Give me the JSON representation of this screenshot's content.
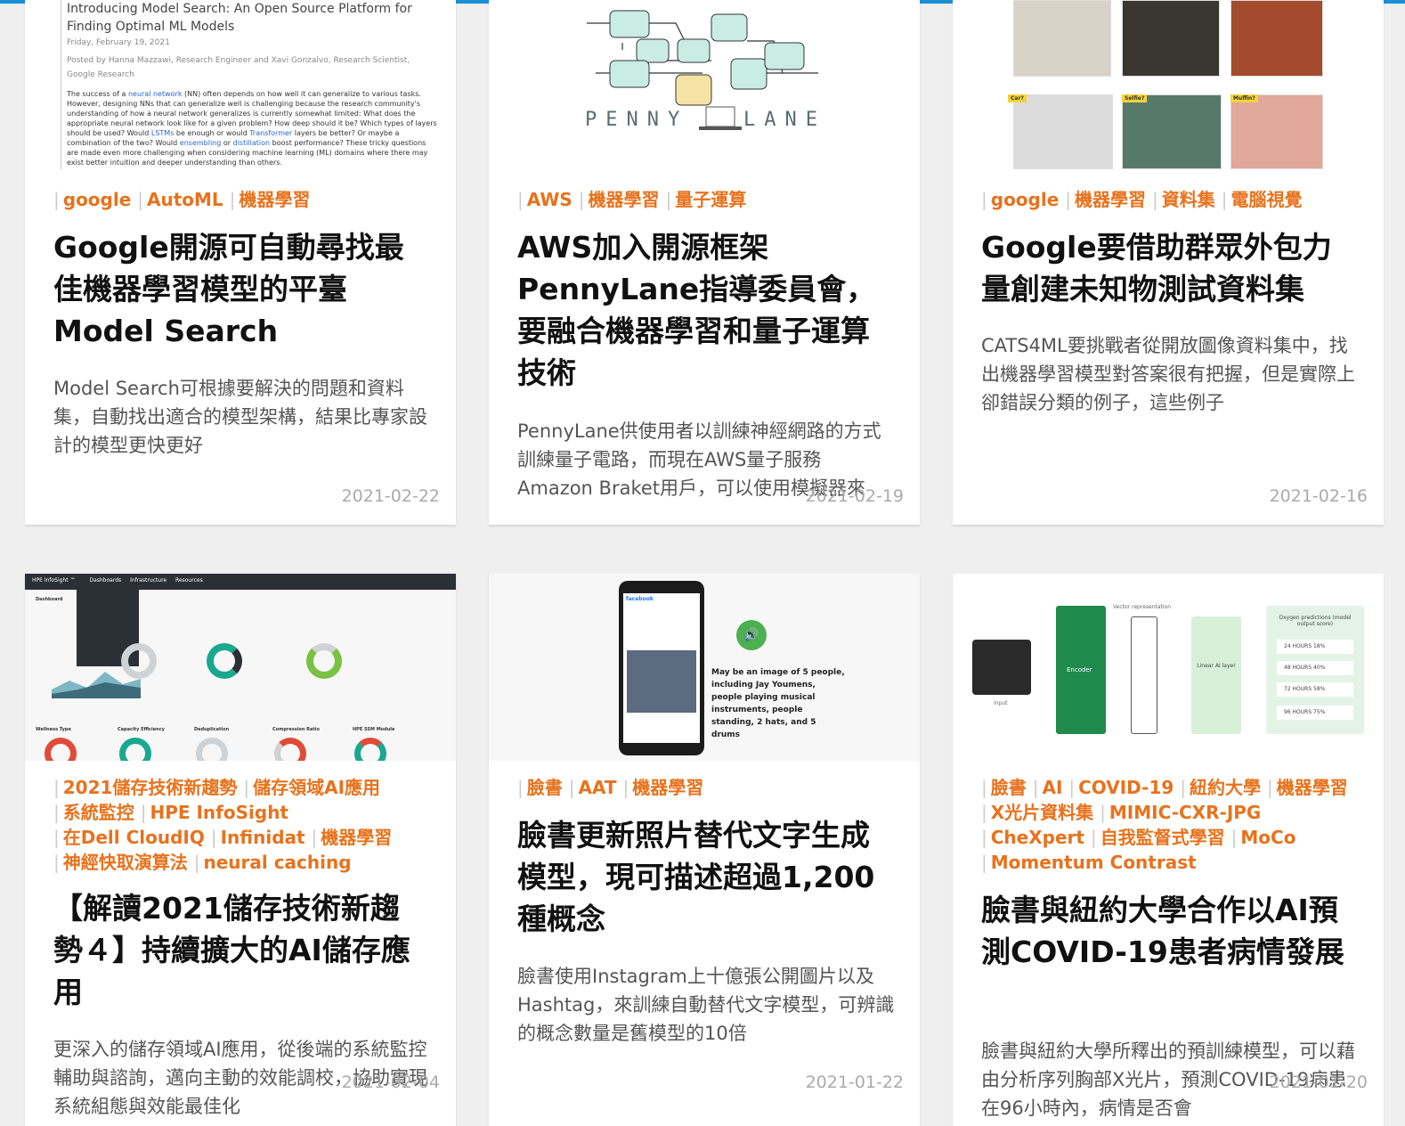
{
  "colors": {
    "accent": "#e8721c",
    "topbar": "#1a8fd6"
  },
  "cards": [
    {
      "thumb": {
        "heading": "Introducing Model Search: An Open Source Platform for Finding Optimal ML Models",
        "date": "Friday, February 19, 2021",
        "byline": "Posted by Hanna Mazzawi, Research Engineer and Xavi Gonzalvo, Research Scientist, Google Research",
        "p1": "The success of a",
        "link1": "neural network",
        "p2": "(NN) often depends on how well it can generalize to various tasks. However, designing NNs that can generalize well is challenging because the research community's understanding of how a neural network generalizes is currently somewhat limited: What does the appropriate neural network look like for a given problem? How deep should it be? Which types of layers should be used? Would",
        "link2": "LSTMs",
        "p3": "be enough or would",
        "link3": "Transformer",
        "p4": "layers be better? Or maybe a combination of the two? Would",
        "link4": "ensembling",
        "p5": "or",
        "link5": "distillation",
        "p6": "boost performance? These tricky questions are made even more challenging when considering machine learning (ML) domains where there may exist better intuition and deeper understanding than others."
      },
      "tags": [
        "google",
        "AutoML",
        "機器學習"
      ],
      "title": "Google開源可自動尋找最佳機器學習模型的平臺Model Search",
      "summary": "Model Search可根據要解決的問題和資料集，自動找出適合的模型架構，結果比專家設計的模型更快更好",
      "date": "2021-02-22"
    },
    {
      "thumb": {
        "word_left": "PENNY",
        "word_right": "LANE"
      },
      "tags": [
        "AWS",
        "機器學習",
        "量子運算"
      ],
      "title": "AWS加入開源框架PennyLane指導委員會，要融合機器學習和量子運算技術",
      "summary": "PennyLane供使用者以訓練神經網路的方式訓練量子電路，而現在AWS量子服務Amazon Braket用戶，可以使用模擬器來",
      "date": "2021-02-19"
    },
    {
      "thumb": {
        "labels": [
          "Car?",
          "Selfie?",
          "Muffin?"
        ]
      },
      "tags": [
        "google",
        "機器學習",
        "資料集",
        "電腦視覺"
      ],
      "title": "Google要借助群眾外包力量創建未知物測試資料集",
      "summary": "CATS4ML要挑戰者從開放圖像資料集中，找出機器學習模型對答案很有把握，但是實際上卻錯誤分類的例子，這些例子",
      "date": "2021-02-16"
    },
    {
      "thumb": {
        "brand": "HPE InfoSight ™",
        "nav": [
          "Dashboards",
          "Infrastructure",
          "Resources"
        ],
        "dashboard": "Dashboard",
        "panels": [
          "Wellness Type",
          "Capacity Efficiency",
          "Deduplication",
          "Compression Ratio",
          "HPE SSM Module"
        ]
      },
      "tags": [
        "2021儲存技術新趨勢",
        "儲存領域AI應用",
        "系統監控",
        "HPE InfoSight",
        "在Dell CloudIQ",
        "Infinidat",
        "機器學習",
        "神經快取演算法",
        "neural caching"
      ],
      "title": "【解讀2021儲存技術新趨勢４】持續擴大的AI儲存應用",
      "summary": "更深入的儲存領域AI應用，從後端的系統監控輔助與諮詢，邁向主動的效能調校，協助實現系統組態與效能最佳化",
      "date": "2021-02-04"
    },
    {
      "thumb": {
        "app": "facebook",
        "caption": "May be an image of 5 people, including Jay Youmens, people playing musical instruments, people standing, 2 hats, and 5 drums"
      },
      "tags": [
        "臉書",
        "AAT",
        "機器學習"
      ],
      "title": "臉書更新照片替代文字生成模型，現可描述超過1,200種概念",
      "summary": "臉書使用Instagram上十億張公開圖片以及Hashtag，來訓練自動替代文字模型，可辨識的概念數量是舊模型的10倍",
      "date": "2021-01-22"
    },
    {
      "thumb": {
        "vector": "Vector representation",
        "encoder": "Encoder",
        "linear": "Linear AI layer",
        "input": "Input",
        "pred_title": "Oxygen predictions (model output score)",
        "preds": [
          "24 HOURS  18%",
          "48 HOURS  40%",
          "72 HOURS  58%",
          "96 HOURS  75%"
        ]
      },
      "tags": [
        "臉書",
        "AI",
        "COVID-19",
        "紐約大學",
        "機器學習",
        "X光片資料集",
        "MIMIC-CXR-JPG",
        "CheXpert",
        "自我監督式學習",
        "MoCo",
        "Momentum Contrast"
      ],
      "title": "臉書與紐約大學合作以AI預測COVID-19患者病情發展",
      "summary": "臉書與紐約大學所釋出的預訓練模型，可以藉由分析序列胸部X光片，預測COVID-19病患在96小時內，病情是否會",
      "date": "2021-01-20"
    }
  ]
}
